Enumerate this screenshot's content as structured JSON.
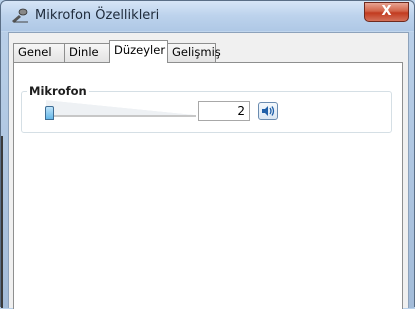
{
  "window": {
    "title": "Mikrofon Özellikleri",
    "close_label": "X"
  },
  "tabs": [
    {
      "label": "Genel",
      "active": false
    },
    {
      "label": "Dinle",
      "active": false
    },
    {
      "label": "Düzeyler",
      "active": true
    },
    {
      "label": "Gelişmiş",
      "active": false
    }
  ],
  "levels": {
    "group_label": "Mikrofon",
    "slider_value_fraction": 0.02,
    "value_text": "2",
    "speaker_icon": "speaker-icon"
  },
  "colors": {
    "title_bar": "#bcd2ec",
    "close_button": "#c23b20",
    "slider_thumb": "#63b6e8"
  }
}
